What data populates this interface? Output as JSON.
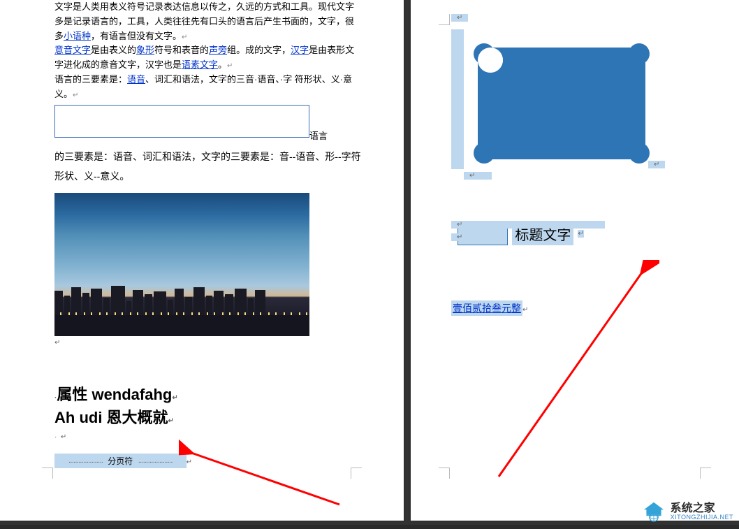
{
  "leftPage": {
    "para1_seg1": "文字是人类用表义符号记录表达信息以传之，久远的方式和工具。现代文字多是记录语言的，工具，人类往往先有口头的语言后产生书面的，文字，很多",
    "link_small_lang": "小语种",
    "para1_seg2": "，有语言但没有文字。",
    "link_ideogram": "意音文字",
    "para1_seg3": "是由表义的",
    "link_pictograph": "象形",
    "para1_seg4": "符号和表音的",
    "link_phonogram": "声旁",
    "para1_seg5": "组。成的文字，",
    "link_hanzi": "汉字",
    "para1_seg6": "是由表形文字进化成的意音文字，汉字也是",
    "link_morpheme": "语素文字",
    "para1_seg7": "。",
    "para1_seg8": "语言的三要素是：",
    "link_phonetics": "语音",
    "para1_seg9": "、词汇和语法，文字的三音·语音、·字 符形状、义·意义。",
    "after_box_text": "语言",
    "para2": "的三要素是：语音、词汇和语法，文字的三要素是：音--语音、形--字符形状、义--意义。",
    "heading_line1": "属性 wendafahg",
    "heading_line2": "Ah udi 恩大概就",
    "page_break_label": "分页符"
  },
  "rightPage": {
    "caption_label": "标题文字",
    "amount_text": "壹佰贰拾叁元整"
  },
  "watermark": {
    "title": "系统之家",
    "sub": "XITONGZHIJIA.NET"
  }
}
